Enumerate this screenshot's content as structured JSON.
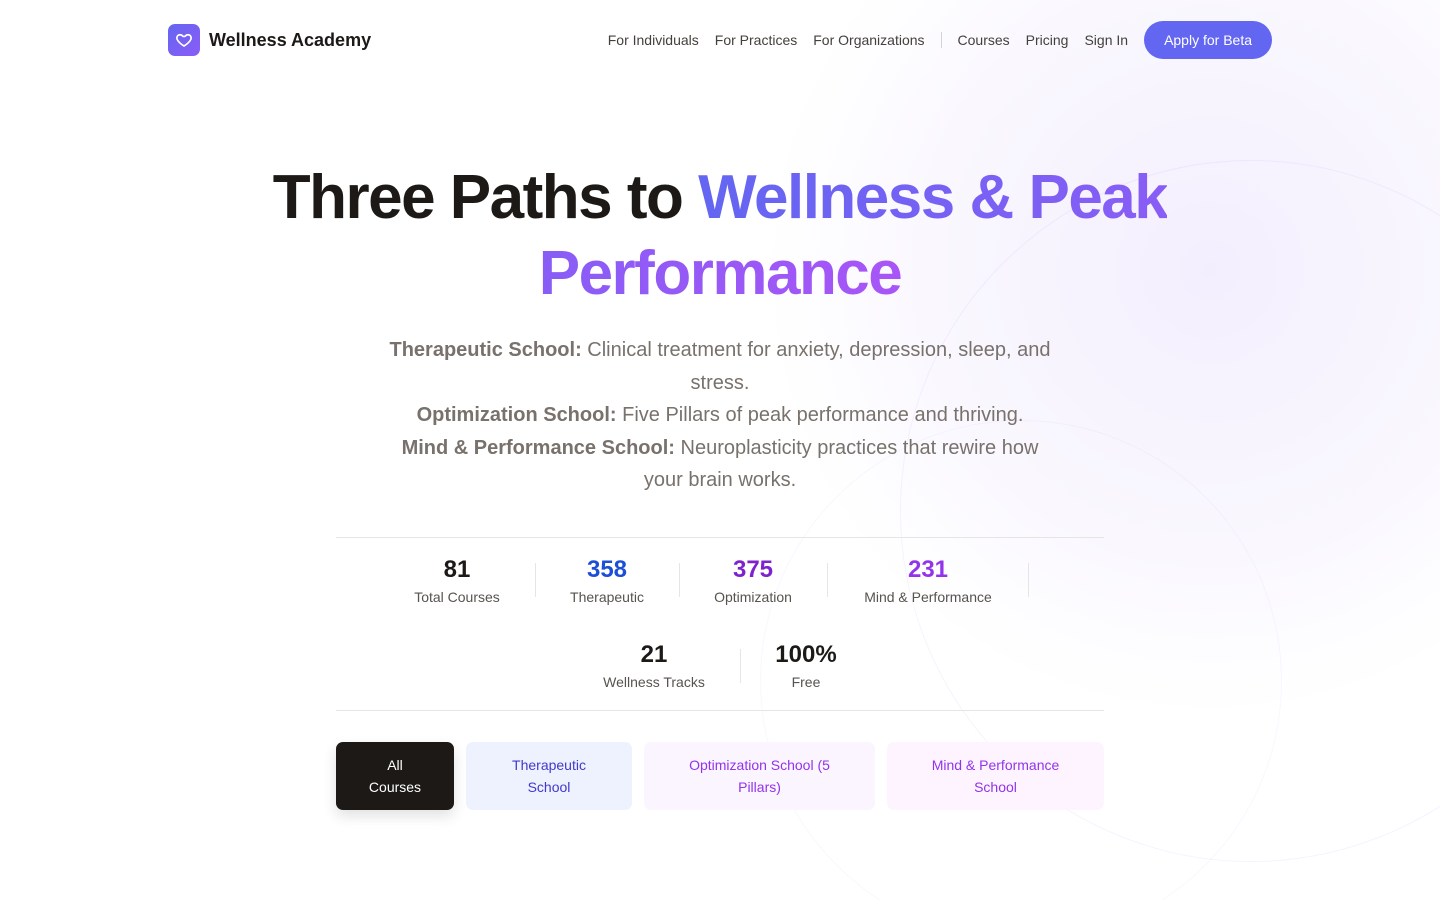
{
  "brand": {
    "name": "Wellness Academy",
    "logo_icon": "heart-icon",
    "logo_color": "#6366f1"
  },
  "nav": {
    "links": [
      "For Individuals",
      "For Practices",
      "For Organizations",
      "Courses",
      "Pricing",
      "Sign In"
    ],
    "cta": "Apply for Beta"
  },
  "hero": {
    "title_dark": "Three Paths to",
    "title_accent": "Wellness & Peak Performance",
    "lines": [
      {
        "label": "Therapeutic School:",
        "text": "Clinical treatment for anxiety, depression, sleep, and stress."
      },
      {
        "label": "Optimization School:",
        "text": "Five Pillars of peak performance and thriving."
      },
      {
        "label": "Mind & Performance School:",
        "text": "Neuroplasticity practices that rewire how your brain works."
      }
    ]
  },
  "stats": [
    {
      "value": "81",
      "label": "Total Courses",
      "color": "#1c1917"
    },
    {
      "value": "358",
      "label": "Therapeutic",
      "color": "#1d4ed8"
    },
    {
      "value": "375",
      "label": "Optimization",
      "color": "#7e22ce"
    },
    {
      "value": "231",
      "label": "Mind & Performance",
      "color": "#9333ea"
    },
    {
      "value": "21",
      "label": "Wellness Tracks",
      "color": "#1c1917"
    },
    {
      "value": "100%",
      "label": "Free",
      "color": "#1c1917"
    }
  ],
  "filters": [
    {
      "label": "All Courses",
      "active": true
    },
    {
      "label": "Therapeutic School",
      "active": false
    },
    {
      "label": "Optimization School (5 Pillars)",
      "active": false
    },
    {
      "label": "Mind & Performance School",
      "active": false
    }
  ],
  "colors": {
    "accent": "#6366f1",
    "accent_purple": "#8b5cf6",
    "text_dark": "#1c1917",
    "text_muted": "#78716c"
  }
}
